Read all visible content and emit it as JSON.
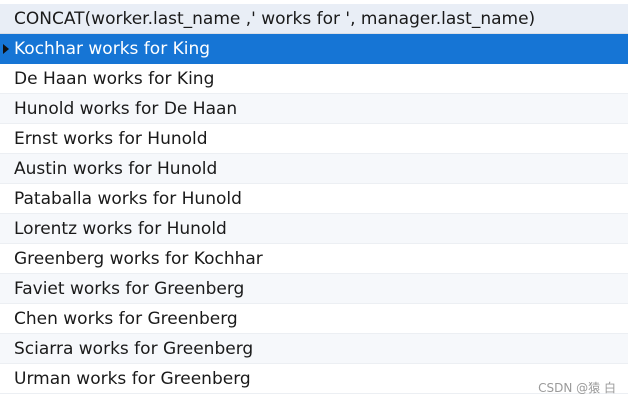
{
  "grid": {
    "column_header": "CONCAT(worker.last_name ,' works for ', manager.last_name)",
    "rows": [
      {
        "value": "Kochhar works for King"
      },
      {
        "value": "De Haan works for King"
      },
      {
        "value": "Hunold works for De Haan"
      },
      {
        "value": "Ernst works for Hunold"
      },
      {
        "value": "Austin works for Hunold"
      },
      {
        "value": "Pataballa works for Hunold"
      },
      {
        "value": "Lorentz works for Hunold"
      },
      {
        "value": "Greenberg works for Kochhar"
      },
      {
        "value": "Faviet works for Greenberg"
      },
      {
        "value": "Chen works for Greenberg"
      },
      {
        "value": "Sciarra works for Greenberg"
      },
      {
        "value": "Urman works for Greenberg"
      }
    ],
    "selected_row_index": 0,
    "colors": {
      "header_bg": "#e9eef6",
      "selected_bg": "#1675d5",
      "alt_row_bg": "#f6f8fb"
    },
    "row_indicator_icon": "current-row-arrow-icon"
  },
  "watermark": "CSDN @猿 白"
}
